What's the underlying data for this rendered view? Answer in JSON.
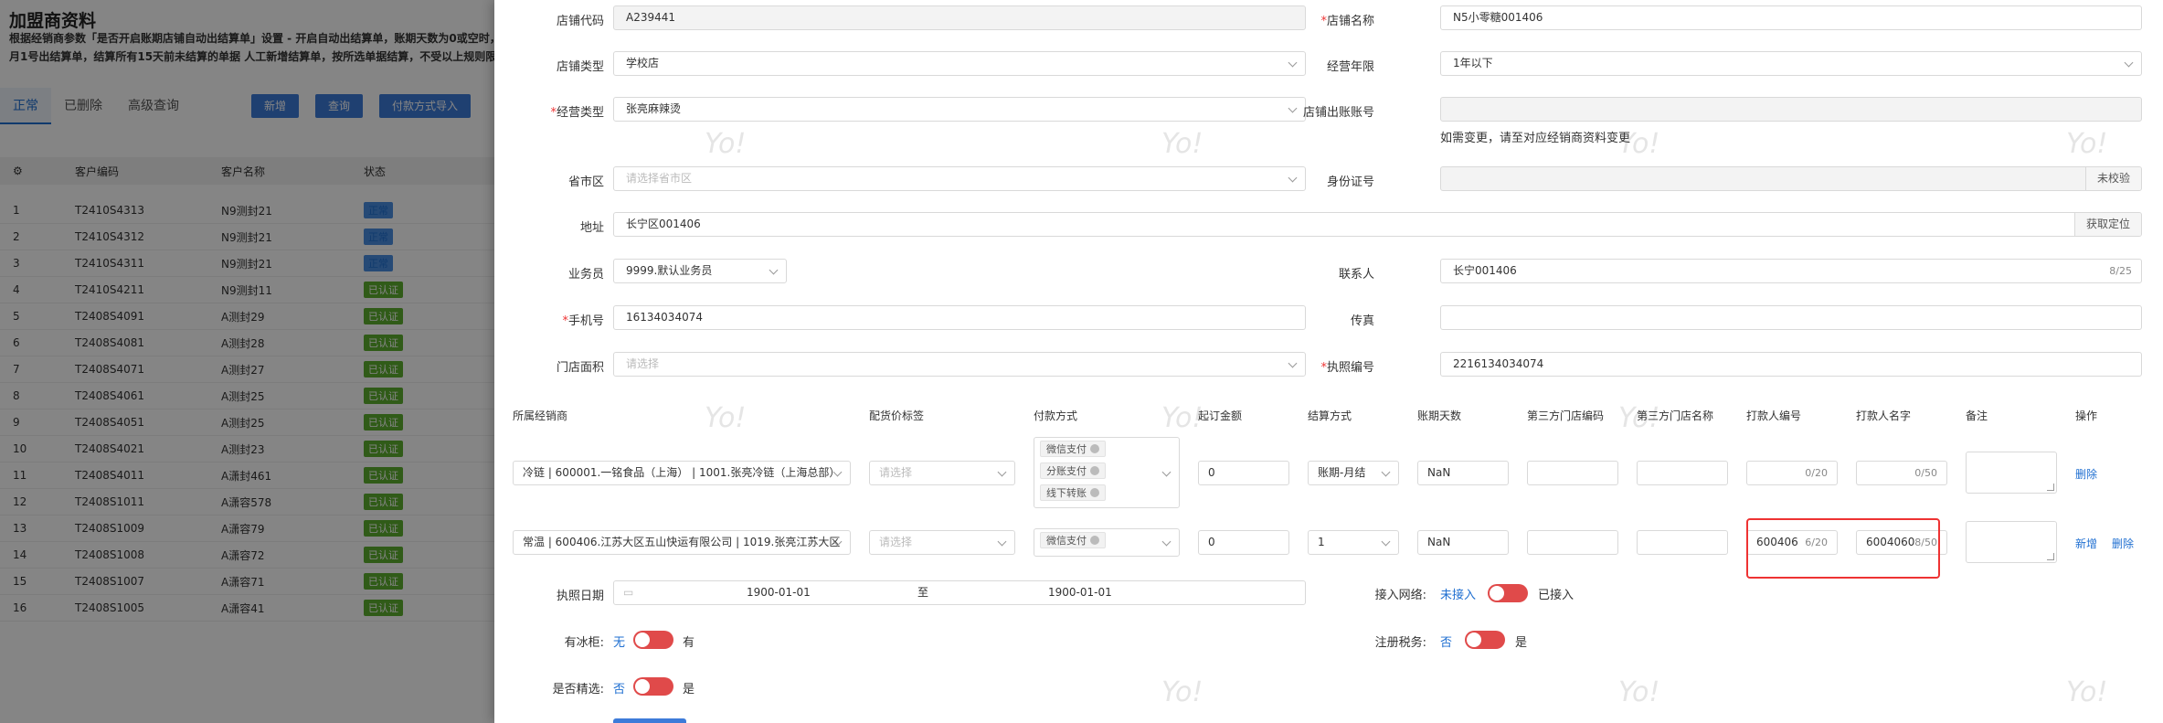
{
  "bg": {
    "title": "加盟商资料",
    "desc_line1": "根据经销商参数「是否开启账期店铺自动出结算单」设置 - 开启自动出结算单，账期天数为0或空时，",
    "desc_line2": "月1号出结算单，结算所有15天前未结算的单据 人工新增结算单，按所选单据结算，不受以上规则限制",
    "tabs": [
      "正常",
      "已删除",
      "高级查询"
    ],
    "buttons": [
      "新增",
      "查询",
      "付款方式导入"
    ],
    "columns": [
      "客户编码",
      "客户名称",
      "状态"
    ],
    "rows": [
      {
        "idx": "1",
        "code": "T2410S4313",
        "name": "N9测封21",
        "status": "正常",
        "color": "blue"
      },
      {
        "idx": "2",
        "code": "T2410S4312",
        "name": "N9测封21",
        "status": "正常",
        "color": "blue"
      },
      {
        "idx": "3",
        "code": "T2410S4311",
        "name": "N9测封21",
        "status": "正常",
        "color": "blue"
      },
      {
        "idx": "4",
        "code": "T2410S4211",
        "name": "N9测封11",
        "status": "已认证",
        "color": "green"
      },
      {
        "idx": "5",
        "code": "T2408S4091",
        "name": "A测封29",
        "status": "已认证",
        "color": "green"
      },
      {
        "idx": "6",
        "code": "T2408S4081",
        "name": "A测封28",
        "status": "已认证",
        "color": "green"
      },
      {
        "idx": "7",
        "code": "T2408S4071",
        "name": "A测封27",
        "status": "已认证",
        "color": "green"
      },
      {
        "idx": "8",
        "code": "T2408S4061",
        "name": "A测封25",
        "status": "已认证",
        "color": "green"
      },
      {
        "idx": "9",
        "code": "T2408S4051",
        "name": "A测封25",
        "status": "已认证",
        "color": "green"
      },
      {
        "idx": "10",
        "code": "T2408S4021",
        "name": "A测封23",
        "status": "已认证",
        "color": "green"
      },
      {
        "idx": "11",
        "code": "T2408S4011",
        "name": "A潇封461",
        "status": "已认证",
        "color": "green"
      },
      {
        "idx": "12",
        "code": "T2408S1011",
        "name": "A潇容578",
        "status": "已认证",
        "color": "green"
      },
      {
        "idx": "13",
        "code": "T2408S1009",
        "name": "A潇容79",
        "status": "已认证",
        "color": "green"
      },
      {
        "idx": "14",
        "code": "T2408S1008",
        "name": "A潇容72",
        "status": "已认证",
        "color": "green"
      },
      {
        "idx": "15",
        "code": "T2408S1007",
        "name": "A潇容71",
        "status": "已认证",
        "color": "green"
      },
      {
        "idx": "16",
        "code": "T2408S1005",
        "name": "A潇容41",
        "status": "已认证",
        "color": "green"
      }
    ]
  },
  "form": {
    "shop_code_label": "店铺代码",
    "shop_code": "A239441",
    "shop_name_label": "店铺名称",
    "shop_name": "N5小零糖001406",
    "shop_type_label": "店铺类型",
    "shop_type": "学校店",
    "years_label": "经营年限",
    "years": "1年以下",
    "biz_type_label": "经营类型",
    "biz_type": "张亮麻辣烫",
    "bill_account_label": "店铺出账账号",
    "bill_account": "",
    "bill_hint": "如需变更，请至对应经销商资料变更",
    "region_label": "省市区",
    "region_placeholder": "请选择省市区",
    "id_label": "身份证号",
    "id_verify": "未校验",
    "address_label": "地址",
    "address": "长宁区001406",
    "locate": "获取定位",
    "salesman_label": "业务员",
    "salesman": "9999.默认业务员",
    "contact_label": "联系人",
    "contact": "长宁001406",
    "contact_count": "8/25",
    "phone_label": "手机号",
    "phone": "16134034074",
    "fax_label": "传真",
    "fax": "",
    "area_label": "门店面积",
    "area_placeholder": "请选择",
    "license_label": "执照编号",
    "license": "2216134034074"
  },
  "table": {
    "headers": [
      "所属经销商",
      "配货价标签",
      "付款方式",
      "起订金额",
      "结算方式",
      "账期天数",
      "第三方门店编码",
      "第三方门店名称",
      "打款人编号",
      "打款人名字",
      "备注",
      "操作"
    ],
    "rows": [
      {
        "dealer": "冷链 | 600001.一铭食品（上海） | 1001.张亮冷链（上海总部）",
        "price_tag": "请选择",
        "payments": [
          "微信支付",
          "分账支付",
          "线下转账"
        ],
        "min_amount": "0",
        "settle": "账期-月结",
        "days": "NaN",
        "payer_no": "",
        "payer_no_count": "0/20",
        "payer_name": "",
        "payer_name_count": "0/50",
        "actions": [
          "删除"
        ]
      },
      {
        "dealer": "常温 | 600406.江苏大区五山快运有限公司 | 1019.张亮江苏大区",
        "price_tag": "请选择",
        "payments": [
          "微信支付"
        ],
        "min_amount": "0",
        "settle": "1",
        "days": "NaN",
        "payer_no": "600406",
        "payer_no_count": "6/20",
        "payer_name": "6004060",
        "payer_name_count": "8/50",
        "actions": [
          "新增",
          "删除"
        ]
      }
    ]
  },
  "bottom": {
    "license_date_label": "执照日期",
    "date_start": "1900-01-01",
    "date_to": "至",
    "date_end": "1900-01-01",
    "network_label": "接入网络:",
    "network_off": "未接入",
    "network_on": "已接入",
    "fridge_label": "有冰柜:",
    "fridge_off": "无",
    "fridge_on": "有",
    "tax_label": "注册税务:",
    "tax_off": "否",
    "tax_on": "是",
    "select_label": "是否精选:",
    "select_off": "否",
    "select_on": "是"
  },
  "watermark": "Yo!"
}
